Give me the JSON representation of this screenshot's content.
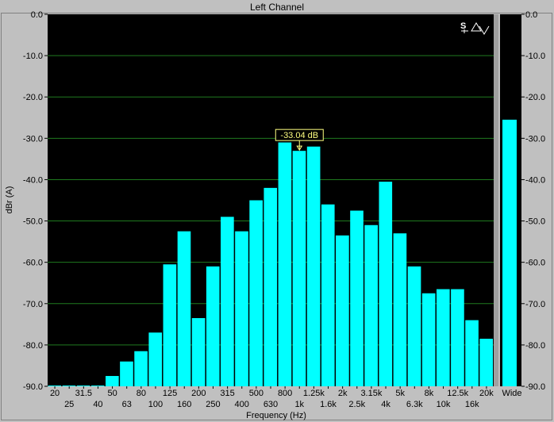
{
  "window": {
    "title": "Left Channel"
  },
  "colors": {
    "background": "#000000",
    "bar": "#00ffff",
    "grid": "#1f7a1f",
    "panel": "#c0c0c0",
    "tooltip": "#ffff80"
  },
  "icons": {
    "top_right": "signal-waveform-icon"
  },
  "tooltip": {
    "text": "-33.04 dB",
    "band_index": 17
  },
  "chart_data": {
    "type": "bar",
    "title": "Left Channel",
    "xlabel": "Frequency (Hz)",
    "ylabel": "dBr (A)",
    "ylim": [
      -90,
      0
    ],
    "yticks": [
      "0.0",
      "-10.0",
      "-20.0",
      "-30.0",
      "-40.0",
      "-50.0",
      "-60.0",
      "-70.0",
      "-80.0",
      "-90.0"
    ],
    "grid": true,
    "categories": [
      "20",
      "25",
      "31.5",
      "40",
      "50",
      "63",
      "80",
      "100",
      "125",
      "160",
      "200",
      "250",
      "315",
      "400",
      "500",
      "630",
      "800",
      "1k",
      "1.25k",
      "1.6k",
      "2k",
      "2.5k",
      "3.15k",
      "4k",
      "5k",
      "6.3k",
      "8k",
      "10k",
      "12.5k",
      "16k",
      "20k"
    ],
    "x_ticks_top_row": [
      "20",
      "31.5",
      "50",
      "80",
      "125",
      "200",
      "315",
      "500",
      "800",
      "1.25k",
      "2k",
      "3.15k",
      "5k",
      "8k",
      "12.5k",
      "20k"
    ],
    "x_ticks_bottom_row": [
      "25",
      "40",
      "63",
      "100",
      "160",
      "250",
      "400",
      "630",
      "1k",
      "1.6k",
      "2.5k",
      "4k",
      "6.3k",
      "10k",
      "16k"
    ],
    "values": [
      -90,
      -90,
      -90,
      -90,
      -87.5,
      -84,
      -81.5,
      -77,
      -60.5,
      -52.5,
      -73.5,
      -61,
      -49,
      -52.5,
      -45,
      -42,
      -31,
      -33.04,
      -32,
      -46,
      -53.5,
      -47.5,
      -51,
      -40.5,
      -53,
      -61,
      -67.5,
      -66.5,
      -66.5,
      -74,
      -78.5
    ]
  },
  "side_meter": {
    "label": "Wide",
    "value": -25.5,
    "ylim": [
      -90,
      0
    ],
    "yticks": [
      "0.0",
      "-10.0",
      "-20.0",
      "-30.0",
      "-40.0",
      "-50.0",
      "-60.0",
      "-70.0",
      "-80.0",
      "-90.0"
    ]
  }
}
